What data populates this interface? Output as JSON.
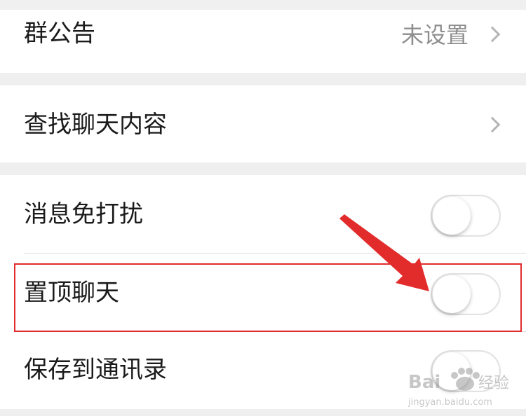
{
  "sections": {
    "notice": {
      "label": "群公告",
      "value": "未设置"
    },
    "search": {
      "label": "查找聊天内容"
    },
    "toggles": [
      {
        "label": "消息免打扰",
        "state": "off"
      },
      {
        "label": "置顶聊天",
        "state": "off"
      },
      {
        "label": "保存到通讯录",
        "state": "off"
      }
    ]
  },
  "annotation": {
    "highlight_color": "#e22b2b",
    "arrow_color": "#e22b2b",
    "target": "置顶聊天"
  },
  "watermark": {
    "brand": "Baidu经验",
    "url": "jingyan.baidu.com"
  }
}
